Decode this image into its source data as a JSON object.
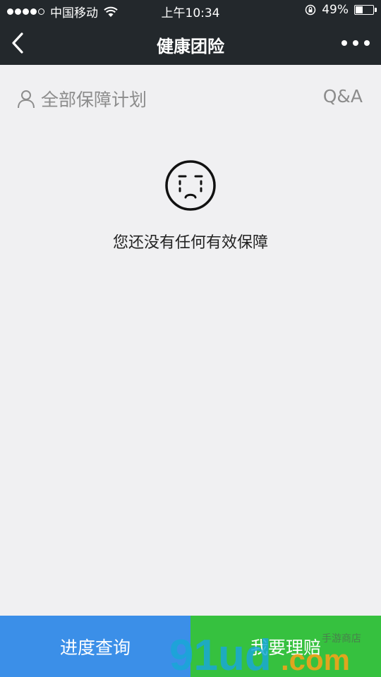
{
  "status_bar": {
    "carrier": "中国移动",
    "time": "上午10:34",
    "battery_percent_text": "49%",
    "battery_level": 0.49
  },
  "nav": {
    "title": "健康团险",
    "back_icon": "chevron-left-icon",
    "more_icon": "more-dots-icon"
  },
  "sub_header": {
    "plans_label": "全部保障计划",
    "plans_icon": "person-icon",
    "qa_label": "Q&A"
  },
  "empty_state": {
    "icon": "sad-face-icon",
    "message": "您还没有任何有效保障"
  },
  "bottom_buttons": {
    "progress_label": "进度查询",
    "claim_label": "我要理赔"
  },
  "watermark": {
    "text": "91ud.com",
    "tagline": "手游商店"
  },
  "colors": {
    "header_bg": "#23282c",
    "page_bg": "#f0f0f2",
    "progress_button": "#3b8fe8",
    "claim_button": "#36c13f",
    "muted_text": "#8c8c8c"
  }
}
